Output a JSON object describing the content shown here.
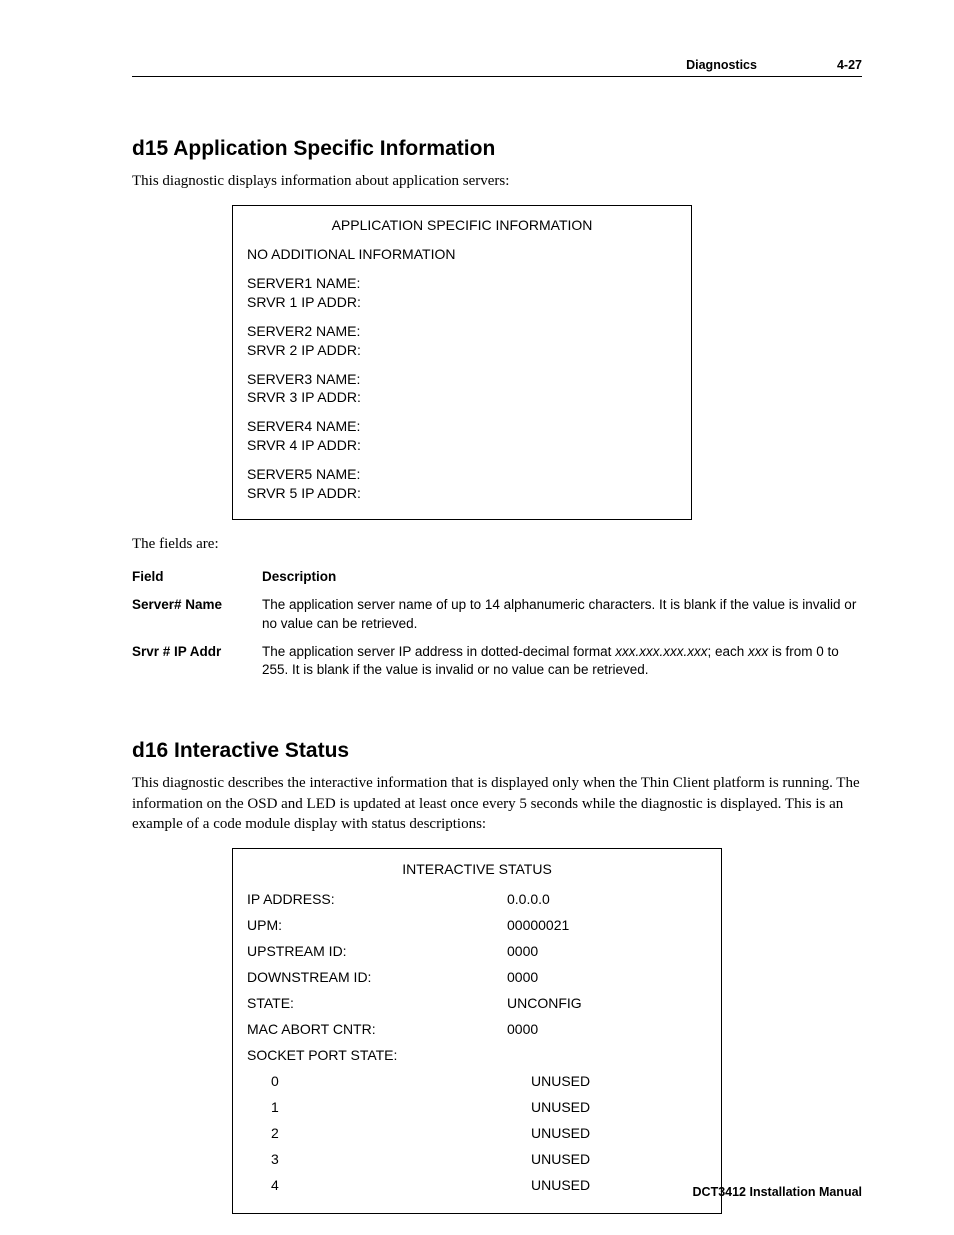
{
  "header": {
    "section": "Diagnostics",
    "page": "4-27"
  },
  "d15": {
    "heading": "d15 Application Specific Information",
    "intro": "This diagnostic displays information about application servers:",
    "panel": {
      "title": "APPLICATION SPECIFIC INFORMATION",
      "line1": "NO ADDITIONAL INFORMATION",
      "servers": [
        {
          "name_label": "SERVER1 NAME:",
          "ip_label": "SRVR 1 IP ADDR:"
        },
        {
          "name_label": "SERVER2 NAME:",
          "ip_label": "SRVR 2 IP ADDR:"
        },
        {
          "name_label": "SERVER3 NAME:",
          "ip_label": "SRVR 3 IP ADDR:"
        },
        {
          "name_label": "SERVER4 NAME:",
          "ip_label": "SRVR 4 IP ADDR:"
        },
        {
          "name_label": "SERVER5 NAME:",
          "ip_label": "SRVR 5 IP ADDR:"
        }
      ]
    },
    "fields_intro": "The fields are:",
    "fields_header": {
      "col1": "Field",
      "col2": "Description"
    },
    "fields": [
      {
        "name": "Server# Name",
        "desc": "The application server name of up to 14 alphanumeric characters. It is blank if the value is invalid or no value can be retrieved."
      },
      {
        "name": "Srvr # IP Addr",
        "desc_pre": "The application server IP address in dotted-decimal format ",
        "desc_em1": "xxx.xxx.xxx.xxx",
        "desc_mid": "; each ",
        "desc_em2": "xxx",
        "desc_post": " is from 0 to 255. It is blank if the value is invalid or no value can be retrieved."
      }
    ]
  },
  "d16": {
    "heading": "d16 Interactive Status",
    "intro": "This diagnostic describes the interactive information that is displayed only when the Thin Client platform is running.  The information on the OSD and LED is updated at least once every 5 seconds while the diagnostic is displayed. This is an example of a code module display with status descriptions:",
    "panel": {
      "title": "INTERACTIVE STATUS",
      "rows": [
        {
          "label": "IP ADDRESS:",
          "value": "0.0.0.0"
        },
        {
          "label": "UPM:",
          "value": "00000021"
        },
        {
          "label": "UPSTREAM ID:",
          "value": "0000"
        },
        {
          "label": "DOWNSTREAM ID:",
          "value": "0000"
        },
        {
          "label": "STATE:",
          "value": "UNCONFIG"
        },
        {
          "label": "MAC ABORT CNTR:",
          "value": "0000"
        }
      ],
      "socket_header": "SOCKET PORT STATE:",
      "sockets": [
        {
          "index": "0",
          "state": "UNUSED"
        },
        {
          "index": "1",
          "state": "UNUSED"
        },
        {
          "index": "2",
          "state": "UNUSED"
        },
        {
          "index": "3",
          "state": "UNUSED"
        },
        {
          "index": "4",
          "state": "UNUSED"
        }
      ]
    }
  },
  "footer": "DCT3412 Installation Manual"
}
